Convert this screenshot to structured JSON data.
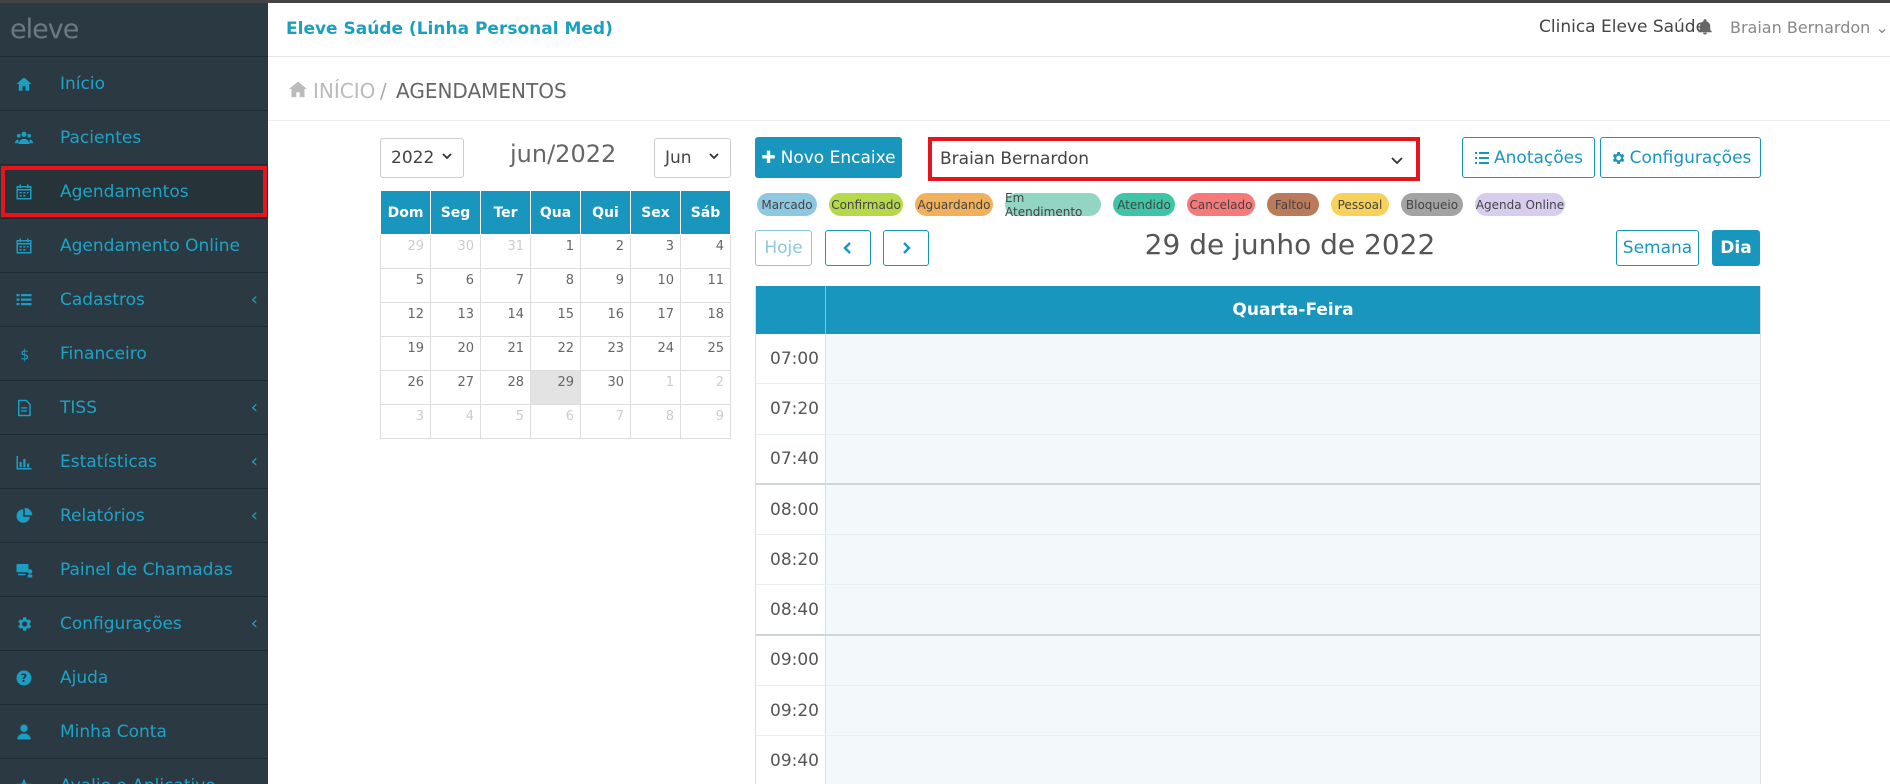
{
  "header": {
    "app_title": "Eleve Saúde (Linha Personal Med)",
    "clinic": "Clinica Eleve Saúde",
    "user": "Braian Bernardon ⌄"
  },
  "logo": "eleve",
  "sidebar": {
    "items": [
      {
        "label": "Início",
        "icon": "home-icon"
      },
      {
        "label": "Pacientes",
        "icon": "users-icon"
      },
      {
        "label": "Agendamentos",
        "icon": "calendar-icon"
      },
      {
        "label": "Agendamento Online",
        "icon": "calendar-icon"
      },
      {
        "label": "Cadastros",
        "icon": "list-icon"
      },
      {
        "label": "Financeiro",
        "icon": "dollar-icon"
      },
      {
        "label": "TISS",
        "icon": "document-icon"
      },
      {
        "label": "Estatísticas",
        "icon": "bar-chart-icon"
      },
      {
        "label": "Relatórios",
        "icon": "pie-chart-icon"
      },
      {
        "label": "Painel de Chamadas",
        "icon": "monitor-icon"
      },
      {
        "label": "Configurações",
        "icon": "gear-icon"
      },
      {
        "label": "Ajuda",
        "icon": "question-icon"
      },
      {
        "label": "Minha Conta",
        "icon": "user-icon"
      },
      {
        "label": "Avalie o Aplicativo",
        "icon": "star-icon"
      }
    ]
  },
  "breadcrumb": {
    "home": "INÍCIO",
    "separator": "/",
    "current": "AGENDAMENTOS"
  },
  "minical": {
    "year_select": "2022",
    "month_select": "Jun",
    "month_label": "jun/2022",
    "weekdays": [
      "Dom",
      "Seg",
      "Ter",
      "Qua",
      "Qui",
      "Sex",
      "Sáb"
    ],
    "rows": [
      [
        "29",
        "30",
        "31",
        "1",
        "2",
        "3",
        "4"
      ],
      [
        "5",
        "6",
        "7",
        "8",
        "9",
        "10",
        "11"
      ],
      [
        "12",
        "13",
        "14",
        "15",
        "16",
        "17",
        "18"
      ],
      [
        "19",
        "20",
        "21",
        "22",
        "23",
        "24",
        "25"
      ],
      [
        "26",
        "27",
        "28",
        "29",
        "30",
        "1",
        "2"
      ],
      [
        "3",
        "4",
        "5",
        "6",
        "7",
        "8",
        "9"
      ]
    ]
  },
  "toolbar": {
    "new_button": "Novo Encaixe",
    "professional": "Braian Bernardon",
    "notes_button": "Anotações",
    "settings_button": "Configurações",
    "today_button": "Hoje",
    "week_button": "Semana",
    "day_button": "Dia",
    "date_title": "29 de junho de 2022"
  },
  "legend": [
    {
      "label": "Marcado",
      "color": "#8dc7e0"
    },
    {
      "label": "Confirmado",
      "color": "#b5d94a"
    },
    {
      "label": "Aguardando",
      "color": "#f1b05c"
    },
    {
      "label": "Em Atendimento",
      "color": "#93d5c4"
    },
    {
      "label": "Atendido",
      "color": "#3fc4a5"
    },
    {
      "label": "Cancelado",
      "color": "#f57a79"
    },
    {
      "label": "Faltou",
      "color": "#bb7a5a"
    },
    {
      "label": "Pessoal",
      "color": "#f6d15b"
    },
    {
      "label": "Bloqueio",
      "color": "#a3a3a3"
    },
    {
      "label": "Agenda Online",
      "color": "#d8cdee"
    }
  ],
  "schedule": {
    "day_header": "Quarta-Feira",
    "times": [
      "07:00",
      "07:20",
      "07:40",
      "08:00",
      "08:20",
      "08:40",
      "09:00",
      "09:20",
      "09:40"
    ]
  }
}
